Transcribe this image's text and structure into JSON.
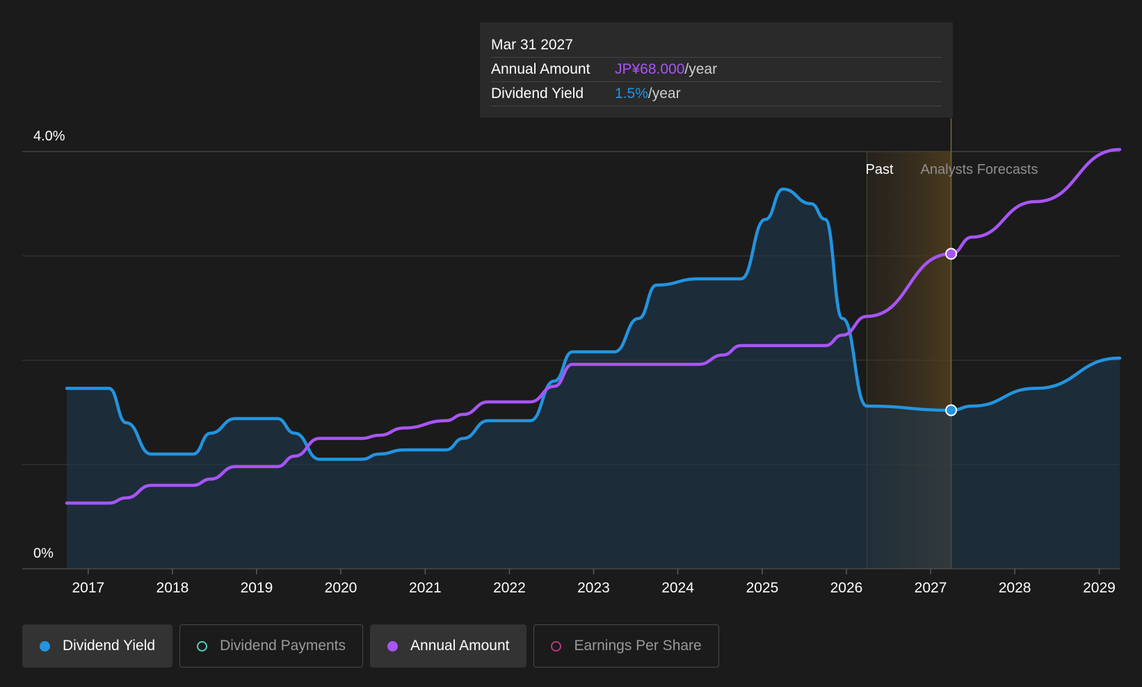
{
  "tooltip": {
    "date": "Mar 31 2027",
    "rows": [
      {
        "label": "Annual Amount",
        "value": "JP¥68.000",
        "unit": "/year",
        "color": "#a855f7"
      },
      {
        "label": "Dividend Yield",
        "value": "1.5%",
        "unit": "/year",
        "color": "#2394df"
      }
    ]
  },
  "legend": [
    {
      "label": "Dividend Yield",
      "color": "#2394df",
      "active": true
    },
    {
      "label": "Dividend Payments",
      "color": "#4fd1c5",
      "active": false
    },
    {
      "label": "Annual Amount",
      "color": "#a855f7",
      "active": true
    },
    {
      "label": "Earnings Per Share",
      "color": "#c0357a",
      "active": false
    }
  ],
  "chart_data": {
    "type": "line",
    "y_tick_labels": [
      "4.0%",
      "0%"
    ],
    "ylim": [
      0,
      4.0
    ],
    "xlim": [
      "2016-09-30",
      "2029-03-31"
    ],
    "x_tick_labels": [
      "2017",
      "2018",
      "2019",
      "2020",
      "2021",
      "2022",
      "2023",
      "2024",
      "2025",
      "2026",
      "2027",
      "2028",
      "2029"
    ],
    "past_label": "Past",
    "forecast_label": "Analysts Forecasts",
    "past_forecast_boundary": "2026-03-31",
    "highlight_date": "2027-03-31",
    "grid": true,
    "series": [
      {
        "name": "Dividend Yield",
        "color": "#2394df",
        "area": true,
        "points": [
          [
            "2016-09-30",
            1.73
          ],
          [
            "2017-04-01",
            1.73
          ],
          [
            "2017-06-15",
            1.4
          ],
          [
            "2017-10-01",
            1.1
          ],
          [
            "2018-04-01",
            1.1
          ],
          [
            "2018-06-15",
            1.3
          ],
          [
            "2018-10-01",
            1.44
          ],
          [
            "2019-04-01",
            1.44
          ],
          [
            "2019-06-15",
            1.3
          ],
          [
            "2019-10-01",
            1.05
          ],
          [
            "2020-04-01",
            1.05
          ],
          [
            "2020-06-15",
            1.1
          ],
          [
            "2020-10-01",
            1.14
          ],
          [
            "2021-04-01",
            1.14
          ],
          [
            "2021-06-15",
            1.25
          ],
          [
            "2021-10-01",
            1.42
          ],
          [
            "2022-04-01",
            1.42
          ],
          [
            "2022-07-15",
            1.8
          ],
          [
            "2022-10-01",
            2.08
          ],
          [
            "2023-04-01",
            2.08
          ],
          [
            "2023-07-15",
            2.4
          ],
          [
            "2023-10-01",
            2.72
          ],
          [
            "2024-04-01",
            2.78
          ],
          [
            "2024-10-01",
            2.78
          ],
          [
            "2025-01-15",
            3.35
          ],
          [
            "2025-04-01",
            3.64
          ],
          [
            "2025-08-01",
            3.5
          ],
          [
            "2025-10-01",
            3.35
          ],
          [
            "2025-12-15",
            2.4
          ],
          [
            "2026-03-31",
            1.56
          ],
          [
            "2027-03-31",
            1.52
          ],
          [
            "2027-06-30",
            1.56
          ],
          [
            "2028-03-31",
            1.73
          ],
          [
            "2029-03-31",
            2.02
          ]
        ]
      },
      {
        "name": "Annual Amount",
        "color": "#a855f7",
        "area": false,
        "points": [
          [
            "2016-09-30",
            0.63
          ],
          [
            "2017-04-01",
            0.63
          ],
          [
            "2017-06-15",
            0.68
          ],
          [
            "2017-10-01",
            0.8
          ],
          [
            "2018-04-01",
            0.8
          ],
          [
            "2018-06-15",
            0.86
          ],
          [
            "2018-10-01",
            0.98
          ],
          [
            "2019-04-01",
            0.98
          ],
          [
            "2019-06-15",
            1.08
          ],
          [
            "2019-10-01",
            1.25
          ],
          [
            "2020-04-01",
            1.25
          ],
          [
            "2020-06-15",
            1.28
          ],
          [
            "2020-10-01",
            1.35
          ],
          [
            "2021-04-01",
            1.42
          ],
          [
            "2021-06-15",
            1.48
          ],
          [
            "2021-10-01",
            1.6
          ],
          [
            "2022-04-01",
            1.6
          ],
          [
            "2022-07-15",
            1.75
          ],
          [
            "2022-10-01",
            1.96
          ],
          [
            "2023-04-01",
            1.96
          ],
          [
            "2024-04-01",
            1.96
          ],
          [
            "2024-07-15",
            2.05
          ],
          [
            "2024-10-01",
            2.14
          ],
          [
            "2025-10-01",
            2.14
          ],
          [
            "2025-12-15",
            2.24
          ],
          [
            "2026-03-31",
            2.42
          ],
          [
            "2027-03-31",
            3.02
          ],
          [
            "2027-06-30",
            3.18
          ],
          [
            "2028-03-31",
            3.52
          ],
          [
            "2029-03-31",
            4.02
          ]
        ]
      }
    ]
  }
}
